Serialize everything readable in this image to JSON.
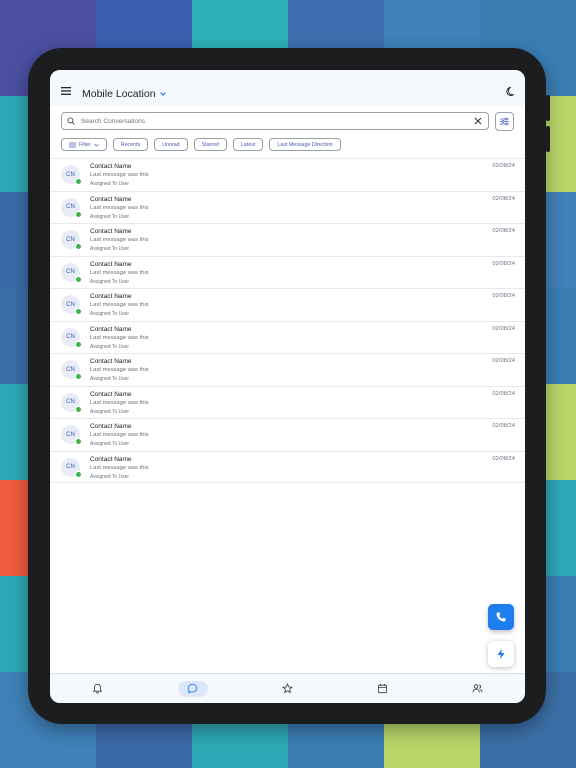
{
  "background": {
    "tiles": [
      "#4a4fa1",
      "#3b5fae",
      "#2eb0b8",
      "#3f6fb0",
      "#3f81b8",
      "#3a7db2",
      "#2ea8b6",
      "#3a7db2",
      "#3f6fb0",
      "#3b6aa9",
      "#3a6fa6",
      "#b9d66a",
      "#3b6aa9",
      "#4a4fa1",
      "#3f6fb0",
      "#3a7db2",
      "#3b5fae",
      "#3f81b8",
      "#3a6fa6",
      "#4a4fa1",
      "#3f6fb0",
      "#3a7db2",
      "#3b6aa9",
      "#3a7db2",
      "#2ea8b6",
      "#3b6aa9",
      "#3a7db2",
      "#3f6fb0",
      "#3a6fa6",
      "#b9d66a",
      "#ee5c3d",
      "#3b6aa9",
      "#3a7db2",
      "#3f6fb0",
      "#3a6fa6",
      "#2ea8b6",
      "#2ea8b6",
      "#3a7db2",
      "#3f6fb0",
      "#2ea8b6",
      "#3a6fa6",
      "#3a7db2",
      "#3f81b8",
      "#3b6aa9",
      "#2ea8b6",
      "#3a7db2",
      "#b9d66a",
      "#3a6fa6"
    ]
  },
  "header": {
    "title": "Mobile Location",
    "menu_icon": "hamburger-menu-icon",
    "theme_icon": "moon-icon"
  },
  "search": {
    "placeholder": "Search Conversations",
    "value": ""
  },
  "chips": {
    "filter": "Filter",
    "recents": "Recents",
    "unread": "Unread",
    "starred": "Starred",
    "latest": "Latest",
    "last_message_direction": "Last Message Direction"
  },
  "conversations": [
    {
      "initials": "CN",
      "name": "Contact Name",
      "message": "Last message was this",
      "assigned": "Assigned To User",
      "date": "02/08/24"
    },
    {
      "initials": "CN",
      "name": "Contact Name",
      "message": "Last message was this",
      "assigned": "Assigned To User",
      "date": "02/08/24"
    },
    {
      "initials": "CN",
      "name": "Contact Name",
      "message": "Last message was this",
      "assigned": "Assigned To User",
      "date": "02/08/24"
    },
    {
      "initials": "CN",
      "name": "Contact Name",
      "message": "Last message was this",
      "assigned": "Assigned To User",
      "date": "02/08/24"
    },
    {
      "initials": "CN",
      "name": "Contact Name",
      "message": "Last message was this",
      "assigned": "Assigned To User",
      "date": "02/08/24"
    },
    {
      "initials": "CN",
      "name": "Contact Name",
      "message": "Last message was this",
      "assigned": "Assigned To User",
      "date": "02/08/24"
    },
    {
      "initials": "CN",
      "name": "Contact Name",
      "message": "Last message was this",
      "assigned": "Assigned To User",
      "date": "02/08/24"
    },
    {
      "initials": "CN",
      "name": "Contact Name",
      "message": "Last message was this",
      "assigned": "Assigned To User",
      "date": "02/08/24"
    },
    {
      "initials": "CN",
      "name": "Contact Name",
      "message": "Last message was this",
      "assigned": "Assigned To User",
      "date": "02/08/24"
    },
    {
      "initials": "CN",
      "name": "Contact Name",
      "message": "Last message was this",
      "assigned": "Assigned To User",
      "date": "02/08/24"
    }
  ],
  "colors": {
    "accent": "#1e7ef0",
    "online": "#3cb54a",
    "chip_text": "#4a5cb8"
  },
  "bottom_nav": {
    "items": [
      "bell-icon",
      "chat-bubble-icon",
      "star-icon",
      "calendar-icon",
      "users-icon"
    ],
    "active": "chat-bubble-icon"
  }
}
